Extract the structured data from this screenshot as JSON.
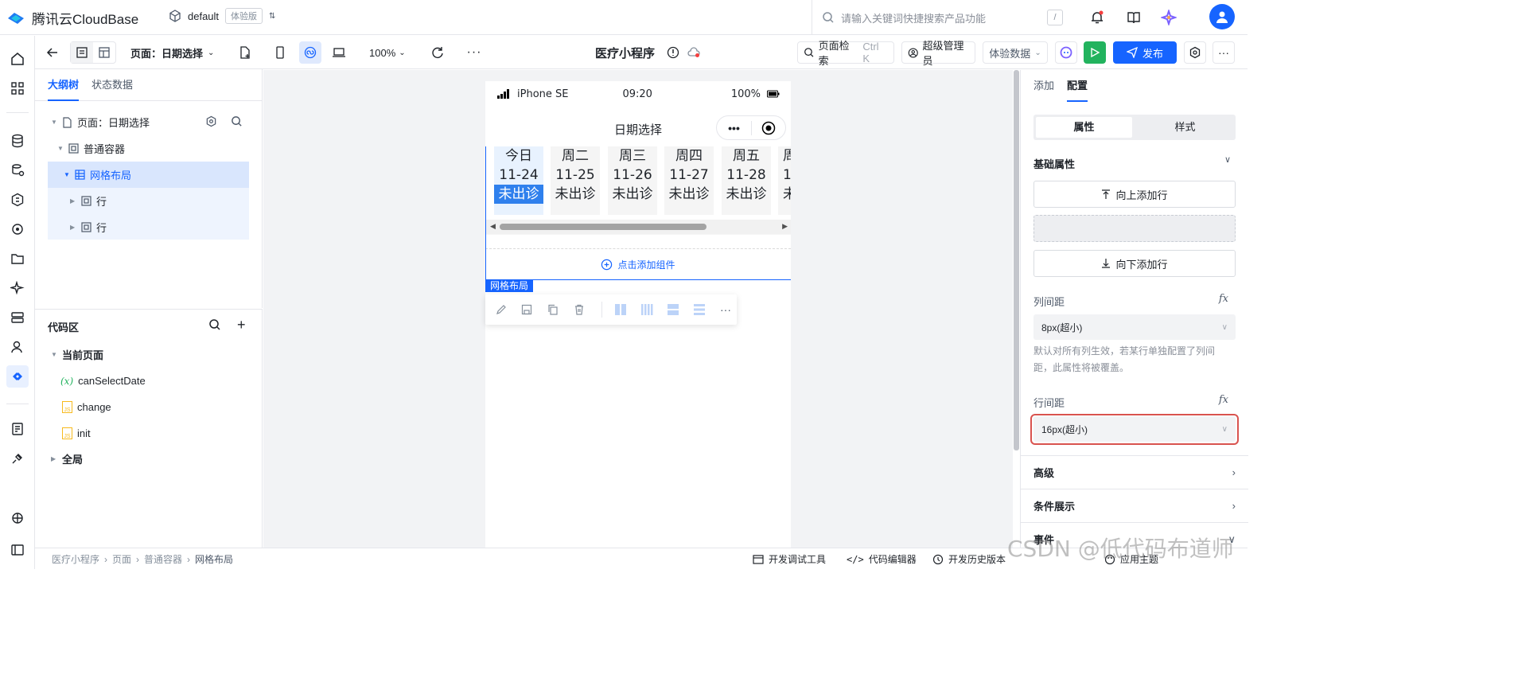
{
  "topbar": {
    "brand": "腾讯云CloudBase",
    "env_name": "default",
    "env_tag": "体验版",
    "search_placeholder": "请输入关键词快捷搜索产品功能",
    "search_shortcut": "/"
  },
  "toolbar": {
    "page_label": "页面：日期选择",
    "zoom": "100%",
    "app_title": "医疗小程序",
    "page_search": "页面检索",
    "page_search_shortcut": "Ctrl K",
    "role": "超级管理员",
    "data_mode": "体验数据",
    "publish": "发布"
  },
  "outline": {
    "tabs": [
      "大纲树",
      "状态数据"
    ],
    "nodes": [
      {
        "label": "页面：日期选择"
      },
      {
        "label": "普通容器"
      },
      {
        "label": "网格布局"
      },
      {
        "label": "行"
      },
      {
        "label": "行"
      }
    ]
  },
  "code_area": {
    "title": "代码区",
    "current_page": "当前页面",
    "items": [
      {
        "icon": "(x)",
        "label": "canSelectDate"
      },
      {
        "icon": "JS",
        "label": "change"
      },
      {
        "icon": "JS",
        "label": "init"
      }
    ],
    "global": "全局"
  },
  "phone": {
    "device": "iPhone SE",
    "time": "09:20",
    "battery": "100%",
    "page_title": "日期选择",
    "days": [
      {
        "weekday": "今日",
        "date": "11-24",
        "status": "未出诊"
      },
      {
        "weekday": "周二",
        "date": "11-25",
        "status": "未出诊"
      },
      {
        "weekday": "周三",
        "date": "11-26",
        "status": "未出诊"
      },
      {
        "weekday": "周四",
        "date": "11-27",
        "status": "未出诊"
      },
      {
        "weekday": "周五",
        "date": "11-28",
        "status": "未出诊"
      },
      {
        "weekday": "周",
        "date": "1",
        "status": "未"
      }
    ],
    "add_component": "点击添加组件",
    "selected_label": "网格布局"
  },
  "right_panel": {
    "tabs": [
      "添加",
      "配置"
    ],
    "segments": [
      "属性",
      "样式"
    ],
    "basic_section": "基础属性",
    "add_row_above": "向上添加行",
    "add_row_below": "向下添加行",
    "col_gap_label": "列间距",
    "col_gap_value": "8px(超小)",
    "col_gap_hint": "默认对所有列生效，若某行单独配置了列间距，此属性将被覆盖。",
    "row_gap_label": "行间距",
    "row_gap_value": "16px(超小)",
    "fx": "fx",
    "advanced": "高级",
    "conditional": "条件展示",
    "events": "事件"
  },
  "bottombar": {
    "breadcrumb": [
      "医疗小程序",
      "页面",
      "普通容器",
      "网格布局"
    ],
    "dev_tools": "开发调试工具",
    "code_editor": "代码编辑器",
    "history": "开发历史版本",
    "theme": "应用主题"
  },
  "watermark": "CSDN @低代码布道师",
  "colors": {
    "primary": "#1664ff",
    "publish_green": "#22b35e",
    "highlight_red": "#d9534f"
  }
}
